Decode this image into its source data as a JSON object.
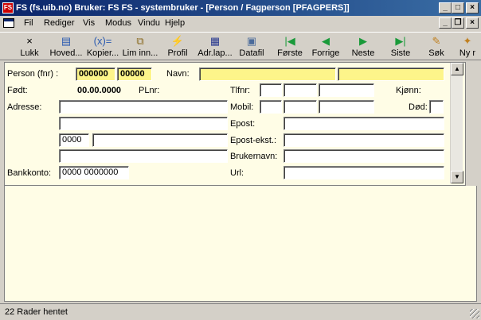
{
  "window": {
    "title": "FS (fs.uib.no) Bruker: FS   FS - systembruker - [Person / Fagperson     [PFAGPERS]]",
    "app_icon": "FS",
    "buttons": {
      "minimize": "_",
      "maximize": "□",
      "close": "×",
      "mdi_minimize": "_",
      "mdi_restore": "❐",
      "mdi_close": "×"
    }
  },
  "menu": [
    "Fil",
    "Rediger",
    "Vis",
    "Modus",
    "Vindu",
    "Hjelp"
  ],
  "toolbar": [
    {
      "label": "Lukk",
      "icon": "close-icon",
      "glyph": "×",
      "color": "#000000"
    },
    {
      "label": "Hoved...",
      "icon": "main-form-icon",
      "glyph": "▤",
      "color": "#2a5ab0"
    },
    {
      "label": "Kopier...",
      "icon": "copy-icon",
      "glyph": "(x)=",
      "color": "#2a5ab0"
    },
    {
      "label": "Lim inn...",
      "icon": "paste-icon",
      "glyph": "⧉",
      "color": "#8a6a20"
    },
    {
      "label": "Profil",
      "icon": "lightning-icon",
      "glyph": "⚡",
      "color": "#d4a000"
    },
    {
      "label": "Adr.lap...",
      "icon": "address-labels-icon",
      "glyph": "▦",
      "color": "#2a3a90"
    },
    {
      "label": "Datafil",
      "icon": "save-disk-icon",
      "glyph": "▣",
      "color": "#4a6a9a"
    },
    {
      "label": "Første",
      "icon": "first-record-icon",
      "glyph": "|◀",
      "color": "#1a9a3a"
    },
    {
      "label": "Forrige",
      "icon": "previous-record-icon",
      "glyph": "◀",
      "color": "#1a9a3a"
    },
    {
      "label": "Neste",
      "icon": "next-record-icon",
      "glyph": "▶",
      "color": "#1a9a3a"
    },
    {
      "label": "Siste",
      "icon": "last-record-icon",
      "glyph": "▶|",
      "color": "#1a9a3a"
    },
    {
      "label": "Søk",
      "icon": "search-flashlight-icon",
      "glyph": "✎",
      "color": "#c08020"
    },
    {
      "label": "Ny r",
      "icon": "new-record-icon",
      "glyph": "✦",
      "color": "#c08020"
    }
  ],
  "form": {
    "labels": {
      "person": "Person  (fnr) :",
      "navn": "Navn:",
      "fodt": "Født:",
      "plnr": "PLnr:",
      "adresse": "Adresse:",
      "bankkonto": "Bankkonto:",
      "tlfnr": "Tlfnr:",
      "mobil": "Mobil:",
      "epost": "Epost:",
      "epost_ekst": "Epost-ekst.:",
      "brukernavn": "Brukernavn:",
      "url": "Url:",
      "kjonn": "Kjønn:",
      "dod": "Død:"
    },
    "values": {
      "fnr_date": "000000",
      "fnr_person": "00000",
      "navn_first": "",
      "navn_last": "",
      "fodt": "00.00.0000",
      "adresse1": "",
      "adresse2": "",
      "postnr": "0000",
      "poststed": "",
      "adresse4": "",
      "bankkonto": "0000 0000000",
      "tlfnr1": "",
      "tlfnr2": "",
      "tlfnr3": "",
      "mobil1": "",
      "mobil2": "",
      "mobil3": "",
      "epost": "",
      "epost_ekst": "",
      "brukernavn": "",
      "url": "",
      "dod": ""
    }
  },
  "scrollbar": {
    "up": "▲",
    "down": "▼"
  },
  "status": {
    "text": "22 Rader hentet"
  },
  "colors": {
    "form_bg": "#fffde6",
    "key_field": "#fdf58a",
    "titlebar": "#0a246a"
  }
}
